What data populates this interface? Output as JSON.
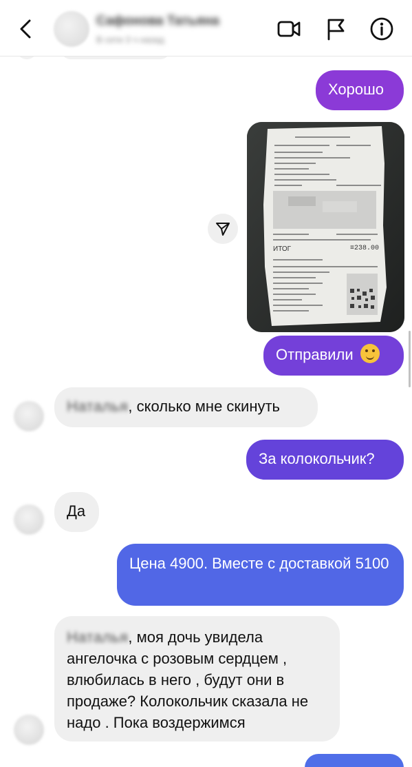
{
  "header": {
    "contact_name": "Сафонова Татьяна",
    "contact_status": "В сети 3 ч назад"
  },
  "messages": [
    {
      "direction": "out",
      "text": "Хорошо"
    },
    {
      "direction": "out",
      "type": "photo"
    },
    {
      "direction": "out",
      "text": "Отправили",
      "emoji": "hugging-face"
    },
    {
      "direction": "in",
      "name": "Наталья",
      "text": ", сколько мне скинуть"
    },
    {
      "direction": "out",
      "text": "За колокольчик?"
    },
    {
      "direction": "in",
      "text": "Да"
    },
    {
      "direction": "out",
      "text": "Цена 4900. Вместе с доставкой 5100"
    },
    {
      "direction": "in",
      "name": "Наталья",
      "text": ", моя дочь увидела ангелочка с розовым сердцем , влюбилась в него , будут они в продаже? Колокольчик сказала не надо . Пока воздержимся"
    }
  ],
  "receipt": {
    "total_label": "ИТОГ",
    "total_value": "≡238.00"
  },
  "colors": {
    "outgoing_purple": "#8a3ad8",
    "outgoing_violet": "#6b42d8",
    "outgoing_blue": "#5067e6",
    "incoming_gray": "#efefef"
  }
}
